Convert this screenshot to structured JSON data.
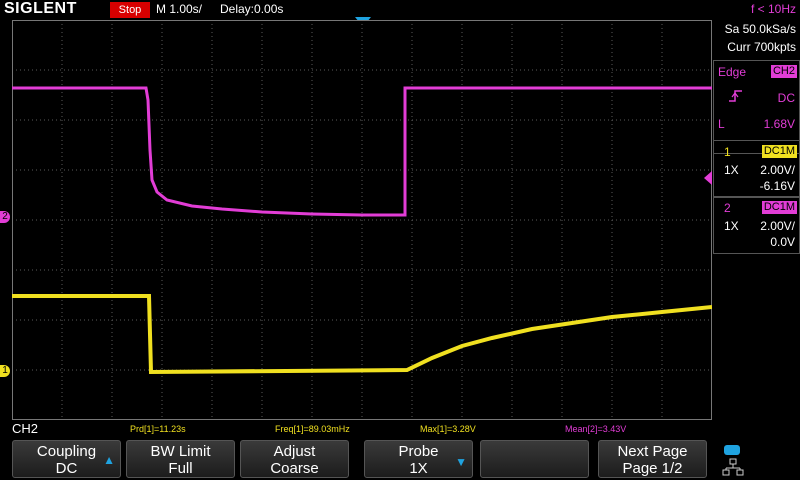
{
  "top": {
    "brand": "SIGLENT",
    "run_state": "Stop",
    "timebase": "M 1.00s/",
    "delay": "Delay:0.00s",
    "trigger_frequency": "f < 10Hz"
  },
  "right_panel": {
    "sample_rate": "Sa 50.0kSa/s",
    "memory_depth": "Curr 700kpts",
    "trigger": {
      "type_label": "Edge",
      "source": "CH2",
      "slope_icon": "rising-edge-icon",
      "coupling": "DC",
      "level_label": "L",
      "level": "1.68V"
    },
    "channels": [
      {
        "number": "1",
        "coupling": "DC1M",
        "probe": "1X",
        "scale": "2.00V/",
        "offset": "-6.16V",
        "color": "#f0e020"
      },
      {
        "number": "2",
        "coupling": "DC1M",
        "probe": "1X",
        "scale": "2.00V/",
        "offset": "0.0V",
        "color": "#e23dd6"
      }
    ]
  },
  "status": {
    "channel": "CH2",
    "measurements": [
      {
        "text": "Prd[1]=11.23s",
        "color": "#f0e020"
      },
      {
        "text": "Freq[1]=89.03mHz",
        "color": "#f0e020"
      },
      {
        "text": "Max[1]=3.28V",
        "color": "#f0e020"
      },
      {
        "text": "Mean[2]=3.43V",
        "color": "#e23dd6"
      }
    ]
  },
  "softkeys": [
    {
      "line1": "Coupling",
      "line2": "DC"
    },
    {
      "line1": "BW Limit",
      "line2": "Full"
    },
    {
      "line1": "Adjust",
      "line2": "Coarse"
    },
    {
      "line1": "Probe",
      "line2": "1X"
    },
    {
      "line1": "",
      "line2": ""
    },
    {
      "line1": "Next Page",
      "line2": "Page 1/2"
    }
  ],
  "markers": {
    "ch1": "1",
    "ch2": "2"
  },
  "colors": {
    "ch1": "#f0e020",
    "ch2": "#e23dd6",
    "accent": "#1fa3e0",
    "stop": "#d80000"
  }
}
